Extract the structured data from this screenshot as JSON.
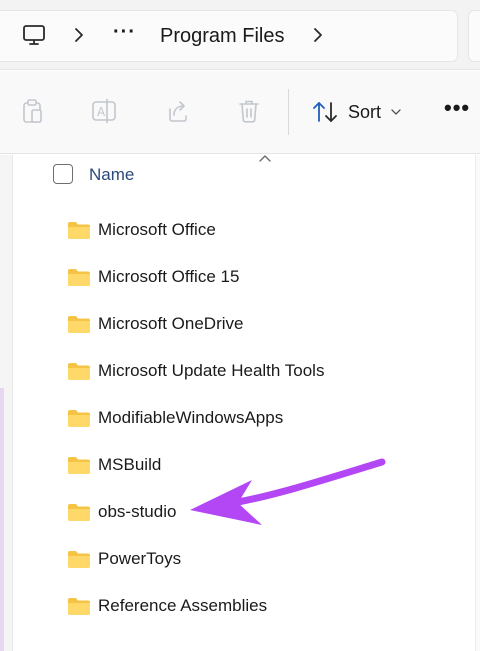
{
  "address_bar": {
    "overflow_glyph": "···",
    "breadcrumb": "Program Files"
  },
  "command_bar": {
    "sort_label": "Sort",
    "more_glyph": "•••"
  },
  "list": {
    "column_name": "Name",
    "items": [
      {
        "label": "Microsoft Office"
      },
      {
        "label": "Microsoft Office 15"
      },
      {
        "label": "Microsoft OneDrive"
      },
      {
        "label": "Microsoft Update Health Tools"
      },
      {
        "label": "ModifiableWindowsApps"
      },
      {
        "label": "MSBuild"
      },
      {
        "label": "obs-studio"
      },
      {
        "label": "PowerToys"
      },
      {
        "label": "Reference Assemblies"
      }
    ]
  },
  "colors": {
    "folder": "#F6C445",
    "arrow": "#B347F5",
    "column_header": "#2B4A7A"
  }
}
